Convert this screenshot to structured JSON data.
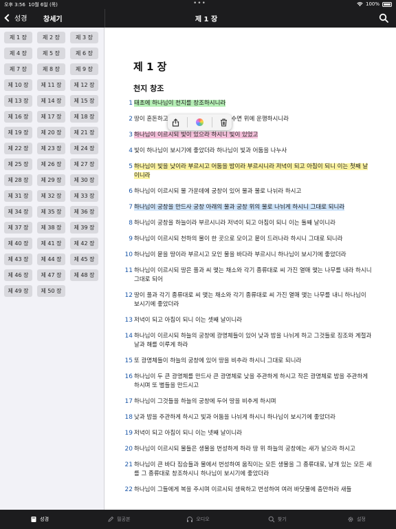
{
  "status": {
    "time": "오후 3:56",
    "date": "10월 6일 (목)",
    "battery": "100%"
  },
  "nav": {
    "back_label": "성경",
    "book_title": "창세기",
    "chapter_title": "제 1 장"
  },
  "chapters": [
    "제 1 장",
    "제 2 장",
    "제 3 장",
    "제 4 장",
    "제 5 장",
    "제 6 장",
    "제 7 장",
    "제 8 장",
    "제 9 장",
    "제 10 장",
    "제 11 장",
    "제 12 장",
    "제 13 장",
    "제 14 장",
    "제 15 장",
    "제 16 장",
    "제 17 장",
    "제 18 장",
    "제 19 장",
    "제 20 장",
    "제 21 장",
    "제 22 장",
    "제 23 장",
    "제 24 장",
    "제 25 장",
    "제 26 장",
    "제 27 장",
    "제 28 장",
    "제 29 장",
    "제 30 장",
    "제 31 장",
    "제 32 장",
    "제 33 장",
    "제 34 장",
    "제 35 장",
    "제 36 장",
    "제 37 장",
    "제 38 장",
    "제 39 장",
    "제 40 장",
    "제 41 장",
    "제 42 장",
    "제 43 장",
    "제 44 장",
    "제 45 장",
    "제 46 장",
    "제 47 장",
    "제 48 장",
    "제 49 장",
    "제 50 장"
  ],
  "content": {
    "heading": "제 1 장",
    "subheading": "천지 창조",
    "verses": [
      {
        "num": "1",
        "text": "태초에 하나님이 천지를 창조하시니라",
        "highlight": "#b5efb5"
      },
      {
        "num": "2",
        "text": "땅이 혼돈하고                   위에 있고 하나님의 영은 수면 위에 운행하시니라",
        "highlight": ""
      },
      {
        "num": "3",
        "text": "하나님이 이르시되 빛이 있으라 하시니 빛이 있었고",
        "highlight": "#f5c1db"
      },
      {
        "num": "4",
        "text": "빛이 하나님이 보시기에 좋았더라 하나님이 빛과 어둠을 나누사",
        "highlight": ""
      },
      {
        "num": "5",
        "text": "하나님이 빛을 낮이라 부르시고 어둠을 밤이라 부르시니라 저녁이 되고 아침이 되니 이는 첫째 날이니라",
        "highlight": "#fbf3a2"
      },
      {
        "num": "6",
        "text": "하나님이 이르시되 물 가운데에 궁창이 있어 물과 물로 나뉘라 하시고",
        "highlight": ""
      },
      {
        "num": "7",
        "text": "하나님이 궁창을 만드사 궁창 아래의 물과 궁창 위의 물로 나뉘게 하시니 그대로 되니라",
        "highlight": "#cfe4fa"
      },
      {
        "num": "8",
        "text": "하나님이 궁창을 하늘이라 부르시니라 저녁이 되고 아침이 되니 이는 둘째 날이니라",
        "highlight": ""
      },
      {
        "num": "9",
        "text": "하나님이 이르시되 천하의 물이 한 곳으로 모이고 뭍이 드러나라 하시니 그대로 되니라",
        "highlight": ""
      },
      {
        "num": "10",
        "text": "하나님이 뭍을 땅이라 부르시고 모인 물을 바다라 부르시니 하나님이 보시기에 좋았더라",
        "highlight": ""
      },
      {
        "num": "11",
        "text": "하나님이 이르시되 땅은 풀과 씨 맺는 채소와 각기 종류대로 씨 가진 열매 맺는 나무를 내라 하시니 그대로 되어",
        "highlight": ""
      },
      {
        "num": "12",
        "text": "땅이 풀과 각기 종류대로 씨 맺는 채소와 각기 종류대로 씨 가진 열매 맺는 나무를 내니 하나님이 보시기에 좋았더라",
        "highlight": ""
      },
      {
        "num": "13",
        "text": "저녁이 되고 아침이 되니 이는 셋째 날이니라",
        "highlight": ""
      },
      {
        "num": "14",
        "text": "하나님이 이르시되 하늘의 궁창에 광명체들이 있어 낮과 밤을 나뉘게 하고 그것들로 징조와 계절과 날과 해를 이루게 하라",
        "highlight": ""
      },
      {
        "num": "15",
        "text": "또 광명체들이 하늘의 궁창에 있어 땅을 비추라 하시니 그대로 되니라",
        "highlight": ""
      },
      {
        "num": "16",
        "text": "하나님이 두 큰 광명체를 만드사 큰 광명체로 낮을 주관하게 하시고 작은 광명체로 밤을 주관하게 하시며 또 별들을 만드시고",
        "highlight": ""
      },
      {
        "num": "17",
        "text": "하나님이 그것들을 하늘의 궁창에 두어 땅을 비추게 하시며",
        "highlight": ""
      },
      {
        "num": "18",
        "text": "낮과 밤을 주관하게 하시고 빛과 어둠을 나뉘게 하시니 하나님이 보시기에 좋았더라",
        "highlight": ""
      },
      {
        "num": "19",
        "text": "저녁이 되고 아침이 되니 이는 넷째 날이니라",
        "highlight": ""
      },
      {
        "num": "20",
        "text": "하나님이 이르시되 물들은 생물을 번성하게 하라 땅 위 하늘의 궁창에는 새가 날으라 하시고",
        "highlight": ""
      },
      {
        "num": "21",
        "text": "하나님이 큰 바다 짐승들과 물에서 번성하여 움직이는 모든 생물을 그 종류대로, 날개 있는 모든 새를 그 종류대로 창조하시니 하나님이 보시기에 좋았더라",
        "highlight": ""
      },
      {
        "num": "22",
        "text": "하나님이 그들에게 복을 주시며 이르시되 생육하고 번성하여 여러 바닷물에 충만하라 새들",
        "highlight": ""
      }
    ]
  },
  "popup": {
    "share_icon": "share-icon",
    "color_icon": "color-palette-icon",
    "delete_icon": "trash-icon"
  },
  "tabs": [
    {
      "label": "성경",
      "icon": "book-icon",
      "active": true
    },
    {
      "label": "필공본",
      "icon": "pen-icon",
      "active": false
    },
    {
      "label": "오디오",
      "icon": "headphones-icon",
      "active": false
    },
    {
      "label": "찾기",
      "icon": "search-icon",
      "active": false
    },
    {
      "label": "설정",
      "icon": "gear-icon",
      "active": false
    }
  ],
  "colors": {
    "accent": "#1a56a8",
    "bar": "#1c1c1e",
    "sidebar": "#f2f2f7"
  }
}
